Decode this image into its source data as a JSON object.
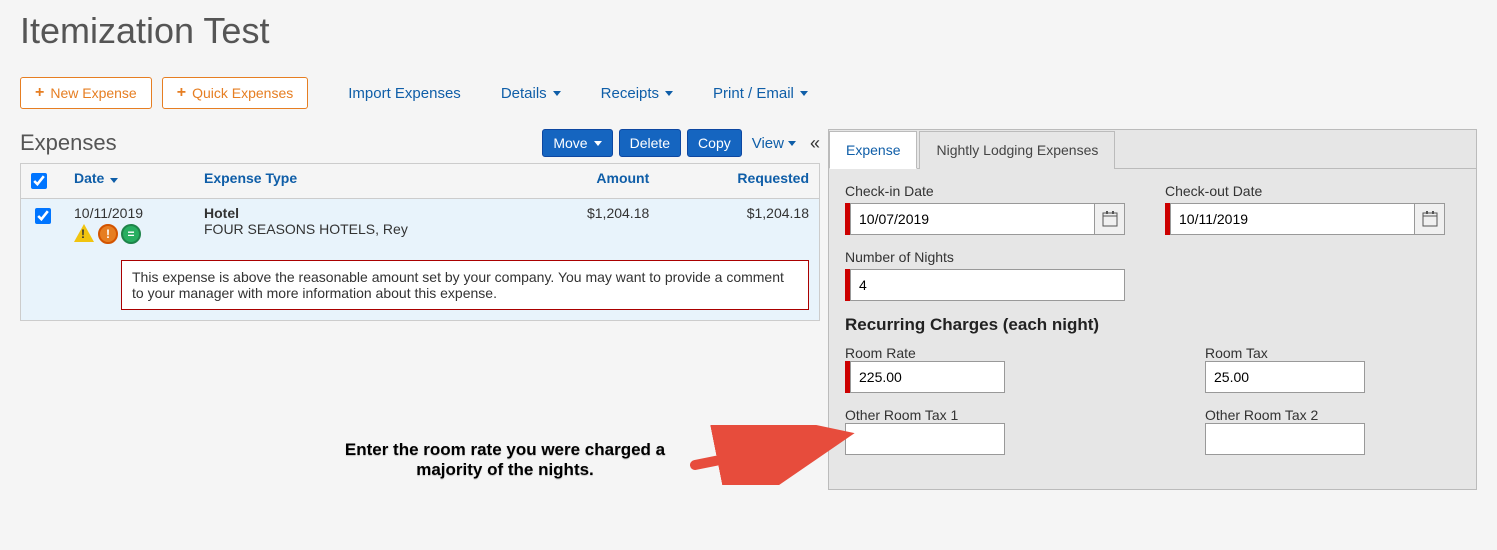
{
  "page_title": "Itemization Test",
  "toolbar": {
    "new_expense": "New Expense",
    "quick_expenses": "Quick Expenses",
    "import_expenses": "Import Expenses",
    "details": "Details",
    "receipts": "Receipts",
    "print_email": "Print / Email"
  },
  "expenses": {
    "heading": "Expenses",
    "move": "Move",
    "delete": "Delete",
    "copy": "Copy",
    "view": "View",
    "cols": {
      "date": "Date",
      "type": "Expense Type",
      "amount": "Amount",
      "requested": "Requested"
    },
    "rows": [
      {
        "date": "10/11/2019",
        "type": "Hotel",
        "vendor": "FOUR SEASONS HOTELS, Rey",
        "amount": "$1,204.18",
        "requested": "$1,204.18"
      }
    ],
    "warning": "This expense is above the reasonable amount set by your company. You may want to provide a comment to your manager with more information about this expense."
  },
  "callout": "Enter the room rate you were charged a majority of the nights.",
  "detail": {
    "tabs": {
      "expense": "Expense",
      "lodging": "Nightly Lodging Expenses"
    },
    "checkin_label": "Check-in Date",
    "checkin_value": "10/07/2019",
    "checkout_label": "Check-out Date",
    "checkout_value": "10/11/2019",
    "nights_label": "Number of Nights",
    "nights_value": "4",
    "recurring_heading": "Recurring Charges (each night)",
    "room_rate_label": "Room Rate",
    "room_rate_value": "225.00",
    "room_tax_label": "Room Tax",
    "room_tax_value": "25.00",
    "other_tax1_label": "Other Room Tax 1",
    "other_tax1_value": "",
    "other_tax2_label": "Other Room Tax 2",
    "other_tax2_value": ""
  }
}
